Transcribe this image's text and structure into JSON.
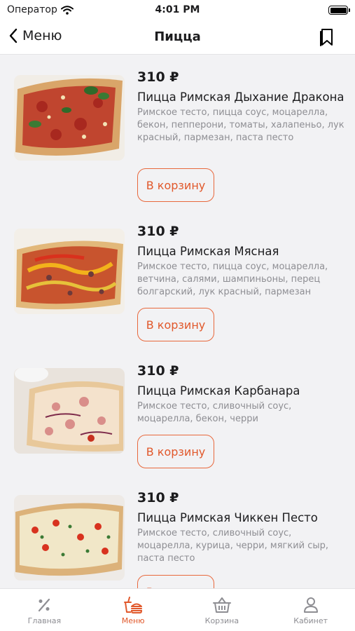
{
  "status_bar": {
    "carrier": "Оператор",
    "time": "4:01 PM"
  },
  "nav": {
    "back_label": "Меню",
    "title": "Пицца"
  },
  "products": [
    {
      "price": "310 ₽",
      "name": "Пицца Римская Дыхание Дракона",
      "description": "Римское тесто, пицца соус, моцарелла, бекон, пепперони, томаты, халапеньо, лук красный, пармезан, паста песто",
      "button": "В корзину"
    },
    {
      "price": "310 ₽",
      "name": "Пицца Римская Мясная",
      "description": "Римское тесто, пицца соус, моцарелла, ветчина, салями, шампиньоны, перец болгарский, лук красный, пармезан",
      "button": "В корзину"
    },
    {
      "price": "310 ₽",
      "name": "Пицца Римская Карбанара",
      "description": "Римское тесто, сливочный соус, моцарелла, бекон, черри",
      "button": "В корзину"
    },
    {
      "price": "310 ₽",
      "name": "Пицца Римская Чиккен Песто",
      "description": "Римское тесто, сливочный соус, моцарелла, курица, черри, мягкий сыр, паста песто",
      "button": "В корзину"
    }
  ],
  "tabs": [
    {
      "label": "Главная",
      "icon": "percent-icon",
      "active": false
    },
    {
      "label": "Меню",
      "icon": "burger-drink-icon",
      "active": true
    },
    {
      "label": "Корзина",
      "icon": "basket-icon",
      "active": false
    },
    {
      "label": "Кабинет",
      "icon": "person-icon",
      "active": false
    }
  ],
  "colors": {
    "accent": "#e1582b",
    "background": "#f2f2f4",
    "muted_text": "#8e8e93"
  }
}
